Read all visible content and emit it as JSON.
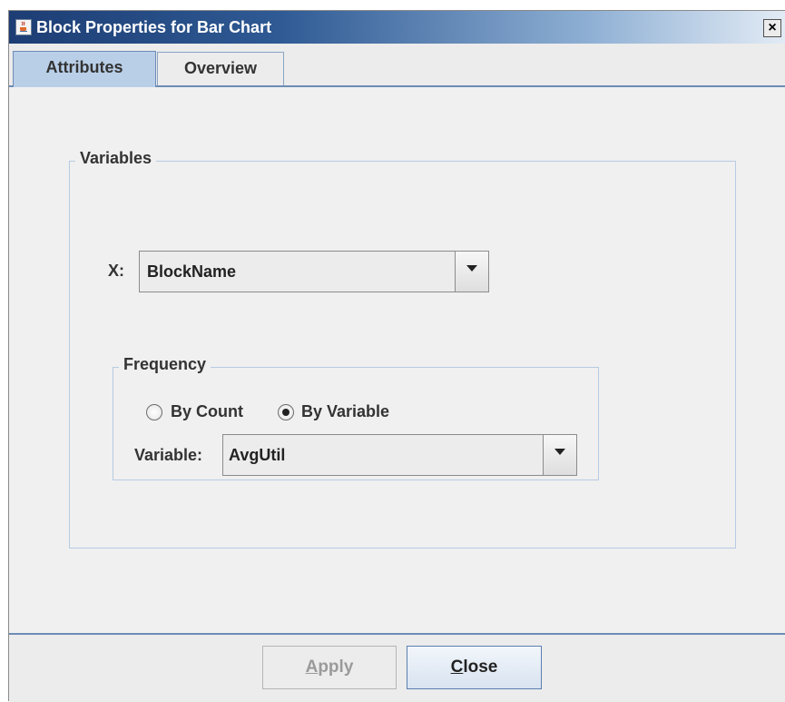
{
  "window": {
    "title": "Block Properties for Bar Chart",
    "close_glyph": "×",
    "icon": "java-coffee-cup-icon"
  },
  "tabs": [
    {
      "label": "Attributes",
      "active": true
    },
    {
      "label": "Overview",
      "active": false
    }
  ],
  "variables_group": {
    "legend": "Variables",
    "x_label": "X:",
    "x_value": "BlockName"
  },
  "frequency_group": {
    "legend": "Frequency",
    "options": [
      {
        "label": "By Count",
        "selected": false
      },
      {
        "label": "By Variable",
        "selected": true
      }
    ],
    "variable_label": "Variable:",
    "variable_value": "AvgUtil"
  },
  "footer": {
    "apply_mnemonic": "A",
    "apply_rest": "pply",
    "apply_enabled": false,
    "close_mnemonic": "C",
    "close_rest": "lose"
  },
  "colors": {
    "title_gradient_start": "#1d3d74",
    "tab_active": "#b9cfe8",
    "group_border": "#b6cbe2"
  }
}
